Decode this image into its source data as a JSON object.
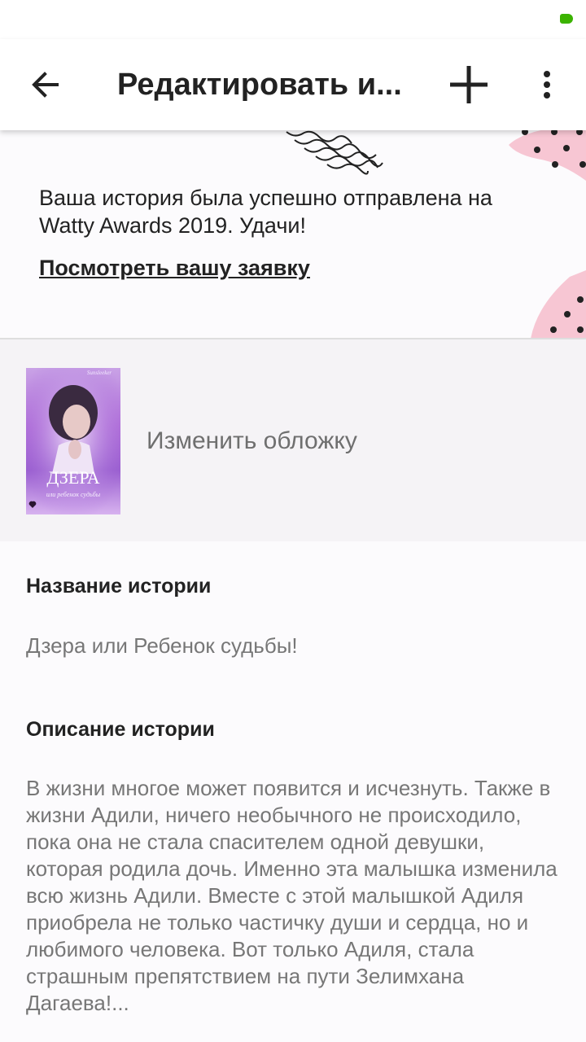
{
  "app_bar": {
    "title": "Редактировать и..."
  },
  "banner": {
    "message": "Ваша история была успешно отправлена на Watty Awards 2019. Удачи!",
    "link_label": "Посмотреть вашу заявку"
  },
  "cover": {
    "change_label": "Изменить обложку",
    "thumbnail_text": {
      "top": "Sunsleeker",
      "title": "ДЗЕРА",
      "subtitle": "или ребенок судьбы"
    }
  },
  "story": {
    "title_heading": "Название истории",
    "title_value": "Дзера или Ребенок судьбы!",
    "description_heading": "Описание истории",
    "description_value": "В жизни многое может появится и исчезнуть. Также в жизни Адили, ничего необычного не происходило, пока она не стала спасителем одной девушки, которая родила дочь. Именно эта малышка изменила всю жизнь Адили. Вместе с этой малышкой Адиля приобрела не только частичку души и сердца, но и любимого человека. Вот только Адиля, стала страшным препятствием на пути Зелимхана Дагаева!..."
  },
  "icons": {
    "back": "arrow-left-icon",
    "add": "plus-icon",
    "more": "more-vertical-icon",
    "battery": "battery-icon"
  },
  "colors": {
    "accent_pink": "#f7c6d3",
    "battery_green": "#3bb300"
  }
}
